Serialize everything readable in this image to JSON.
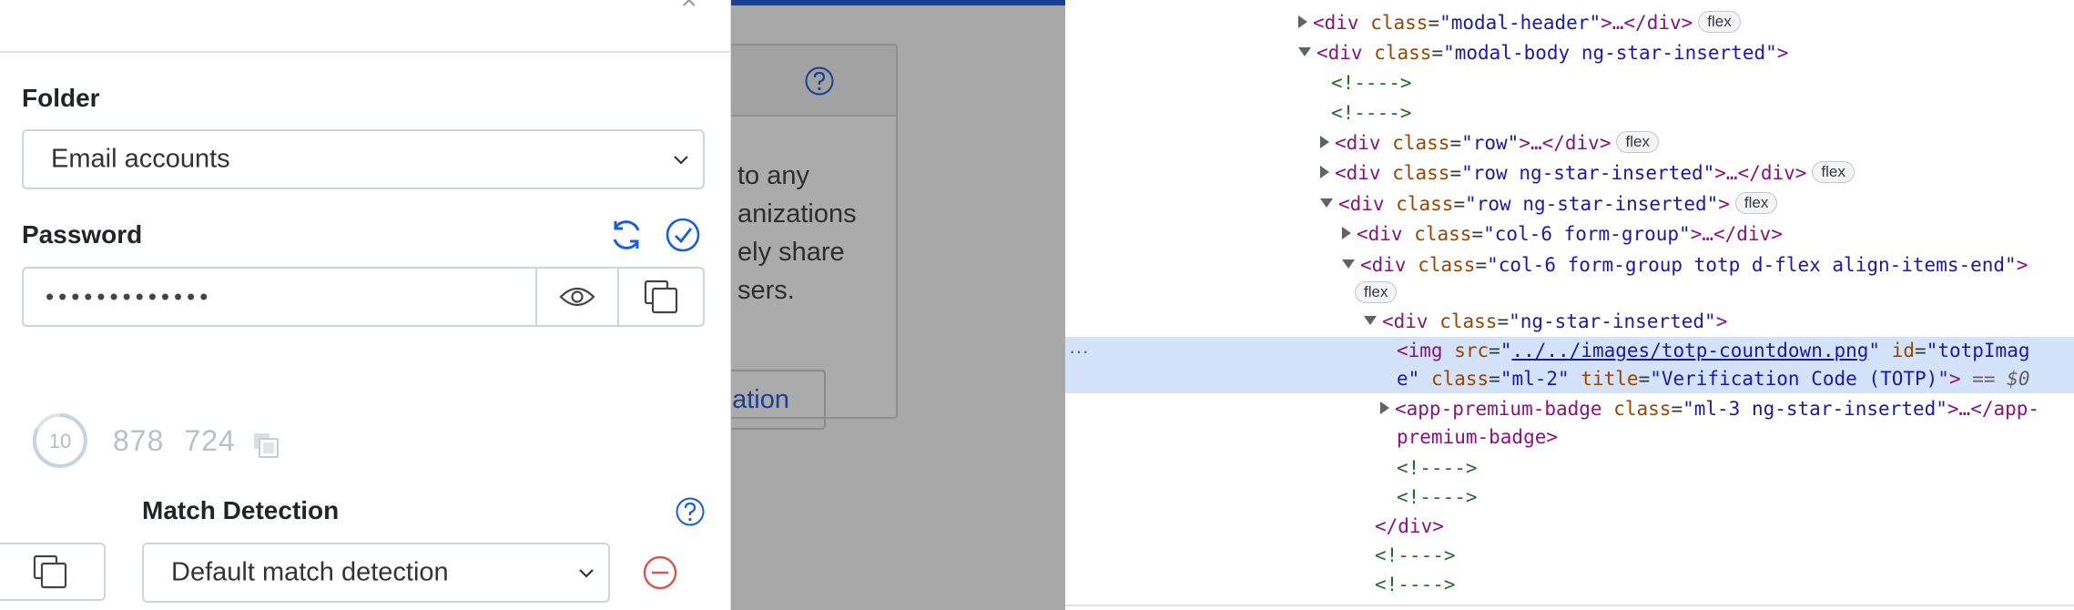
{
  "modal": {
    "folder_label": "Folder",
    "folder_value": "Email accounts",
    "password_label": "Password",
    "password_value": "•••••••••••••",
    "totp_seconds": "10",
    "totp_code_part1": "878",
    "totp_code_part2": "724",
    "match_detection_label": "Match Detection",
    "match_detection_value": "Default match detection"
  },
  "background_page": {
    "line1": "to any",
    "line2": "anizations",
    "line3": "ely share",
    "line4": "sers.",
    "button_label": "nization"
  },
  "devtools": {
    "lines": [
      {
        "tag_open": "<div",
        "attr": "class",
        "val": "\"modal-header\"",
        "rest": ">…</div>",
        "badge": "flex"
      },
      {
        "tag_open": "<div",
        "attr": "class",
        "val": "\"modal-body ng-star-inserted\"",
        "rest": ">"
      },
      {
        "comment": "<!---->"
      },
      {
        "comment": "<!---->"
      },
      {
        "tag_open": "<div",
        "attr": "class",
        "val": "\"row\"",
        "rest": ">…</div>",
        "badge": "flex"
      },
      {
        "tag_open": "<div",
        "attr": "class",
        "val": "\"row ng-star-inserted\"",
        "rest": ">…</div>",
        "badge": "flex"
      },
      {
        "tag_open": "<div",
        "attr": "class",
        "val": "\"row ng-star-inserted\"",
        "rest": ">",
        "badge": "flex"
      },
      {
        "tag_open": "<div",
        "attr": "class",
        "val": "\"col-6 form-group\"",
        "rest": ">…</div>"
      },
      {
        "tag_open": "<div",
        "attr": "class",
        "val": "\"col-6 form-group totp d-flex align-items-end\"",
        "rest": ">"
      },
      {
        "badge": "flex"
      },
      {
        "tag_open": "<div",
        "attr": "class",
        "val": "\"ng-star-inserted\"",
        "rest": ">"
      },
      {
        "img_src_link": "../../images/totp-countdown.png",
        "id_val_a": "\"totpImag",
        "id_val_b": "e\"",
        "class_val": "\"ml-2\"",
        "title_val": "\"Verification Code (TOTP)\"",
        "selected_marker": "== $0"
      },
      {
        "tag_open": "<app-premium-badge",
        "attr": "class",
        "val": "\"ml-3 ng-star-inserted\"",
        "rest": ">…</app-",
        "cont": "premium-badge>"
      },
      {
        "comment": "<!---->"
      },
      {
        "comment": "<!---->"
      },
      {
        "close": "</div>"
      },
      {
        "comment": "<!---->"
      },
      {
        "comment": "<!---->"
      }
    ],
    "more_marker": "···"
  },
  "colors": {
    "accent_blue": "#175ddc",
    "danger_red": "#d9534f",
    "bg_overlay": "#a8a8a8",
    "devtools_selection": "#d4e3f9"
  }
}
